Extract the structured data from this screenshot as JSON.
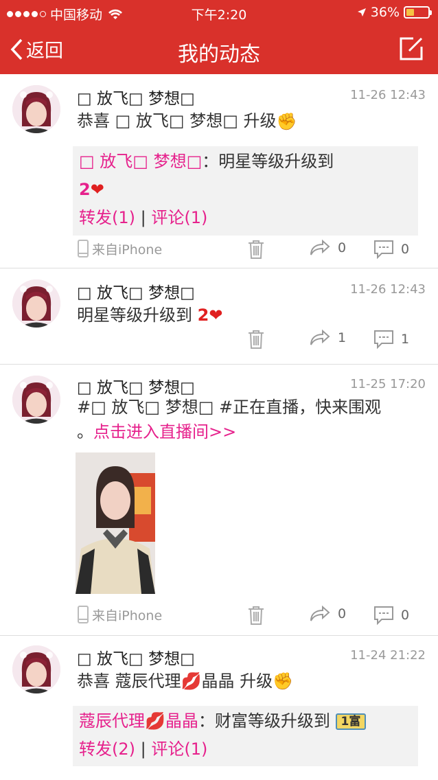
{
  "status_bar": {
    "carrier": "中国移动",
    "time": "下午2:20",
    "battery": "36%",
    "battery_level": 0.36
  },
  "nav": {
    "back_label": "返回",
    "title": "我的动态"
  },
  "posts": [
    {
      "name": "□ 放飞□ 梦想□",
      "time": "11-26 12:43",
      "text": "恭喜 □ 放飞□ 梦想□  升级",
      "quote_user": "□ 放飞□ 梦想□",
      "quote_text": "：明星等级升级到",
      "quote_level": "2",
      "repost": "转发(1)",
      "sep": "|",
      "comment": "评论(1)",
      "source": "来自iPhone",
      "reposts": "0",
      "comments": "0"
    },
    {
      "name": "□ 放飞□ 梦想□",
      "time": "11-26 12:43",
      "text": "明星等级升级到",
      "level": "2",
      "reposts": "1",
      "comments": "1"
    },
    {
      "name": "□ 放飞□ 梦想□",
      "time": "11-25 17:20",
      "text_line1": "#□ 放飞□ 梦想□ #正在直播，快来围观",
      "text_line2_prefix": "。",
      "live_link": "点击进入直播间>>",
      "source": "来自iPhone",
      "reposts": "0",
      "comments": "0"
    },
    {
      "name": "□ 放飞□ 梦想□",
      "time": "11-24 21:22",
      "text_prefix": "恭喜 蔻辰代理",
      "text_suffix": "晶晶 升级",
      "quote_user_prefix": "蔻辰代理",
      "quote_user_suffix": "晶晶",
      "quote_text": "：财富等级升级到",
      "quote_badge": "1富",
      "repost": "转发(2)",
      "sep": "|",
      "comment": "评论(1)"
    }
  ],
  "colors": {
    "brand": "#d9312b",
    "link": "#e6218c"
  }
}
